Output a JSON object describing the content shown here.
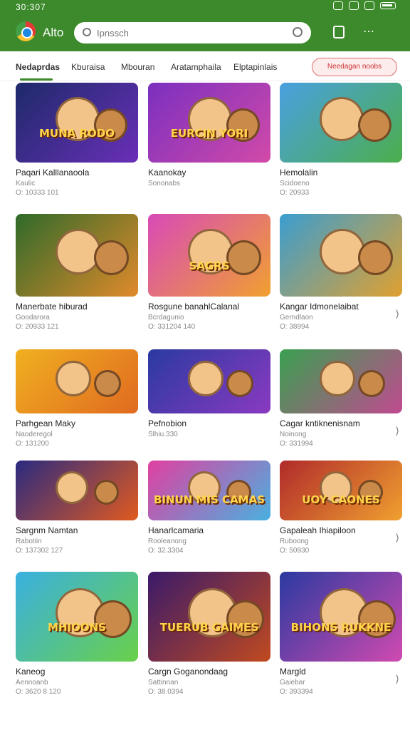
{
  "status": {
    "time": "30:307"
  },
  "header": {
    "app_title": "Alto",
    "search_placeholder": "Ipnssch",
    "more": "⋯"
  },
  "tabs": [
    {
      "label": "Nedaprdas"
    },
    {
      "label": "Kburaisa"
    },
    {
      "label": "Mbouran"
    },
    {
      "label": "Aratamphaila"
    },
    {
      "label": "Elptapinlais"
    }
  ],
  "filter_pill": "Needagan noobs",
  "cards": [
    {
      "name": "Paqari Kalllanaoola",
      "sub": "Kaulic",
      "meta": "O: 10333 101",
      "banner": "MUNA RODO",
      "bg1": "#1d2a6a",
      "bg2": "#6a2fb8"
    },
    {
      "name": "Kaanokay",
      "sub": "Sononabs",
      "meta": "",
      "banner": "EURCIN YORI",
      "bg1": "#7a2fc0",
      "bg2": "#d24aa8"
    },
    {
      "name": "Hemolalin",
      "sub": "Scidoeno",
      "meta": "O: 20933",
      "banner": "",
      "bg1": "#4aa0e0",
      "bg2": "#4cae4c"
    },
    {
      "name": "Manerbate hiburad",
      "sub": "Goodarora",
      "meta": "O: 20933 121",
      "banner": "",
      "bg1": "#2f6a2a",
      "bg2": "#e08a2a"
    },
    {
      "name": "Rosgune banahlCalanal",
      "sub": "Bcrdagunio",
      "meta": "O: 331204 140",
      "banner": "SAGRS",
      "bg1": "#d84ab8",
      "bg2": "#f0a030"
    },
    {
      "name": "Kangar Idmonelaibat",
      "sub": "Gerndlaon",
      "meta": "O: 38994",
      "banner": "",
      "bg1": "#3a9ed0",
      "bg2": "#e0a030"
    },
    {
      "name": "Parhgean Maky",
      "sub": "Naoderegol",
      "meta": "O: 131200",
      "banner": "",
      "bg1": "#f0b020",
      "bg2": "#e06a20"
    },
    {
      "name": "Pefnobion",
      "sub": "Slhiu.330",
      "meta": "",
      "banner": "",
      "bg1": "#2a3aa0",
      "bg2": "#8a3ac0"
    },
    {
      "name": "Cagar kntiknenisnam",
      "sub": "Noinong",
      "meta": "O: 331994",
      "banner": "",
      "bg1": "#3aa050",
      "bg2": "#c04a90"
    },
    {
      "name": "Sargnm Namtan",
      "sub": "Rabotiin",
      "meta": "O: 137302 127",
      "banner": "",
      "bg1": "#2a2a80",
      "bg2": "#e05a20"
    },
    {
      "name": "Hanarlcamaria",
      "sub": "Rooleanong",
      "meta": "O: 32.3304",
      "banner": "BINUN MIS CAMAS",
      "bg1": "#e040a0",
      "bg2": "#4ab0e0"
    },
    {
      "name": "Gapaleah Ihiapiloon",
      "sub": "Ruboong",
      "meta": "O: 50930",
      "banner": "UOY CAONES",
      "bg1": "#b02a2a",
      "bg2": "#f0a030"
    },
    {
      "name": "Kaneog",
      "sub": "Aennoanb",
      "meta": "O: 3620 8 120",
      "banner": "MHIOONS",
      "bg1": "#3ab0e0",
      "bg2": "#6ad04a"
    },
    {
      "name": "Cargn Goganondaag",
      "sub": "Sattinnan",
      "meta": "O: 38.0394",
      "banner": "TUERUB GAIMES",
      "bg1": "#3a1a6a",
      "bg2": "#c04a20"
    },
    {
      "name": "Margld",
      "sub": "Gaiebar",
      "meta": "O: 393394",
      "banner": "BIHONS RUKKNE",
      "bg1": "#2a3aa0",
      "bg2": "#d04ab0"
    }
  ],
  "colors": {
    "header_green": "#3c8a2b",
    "pill_red": "#c33"
  }
}
